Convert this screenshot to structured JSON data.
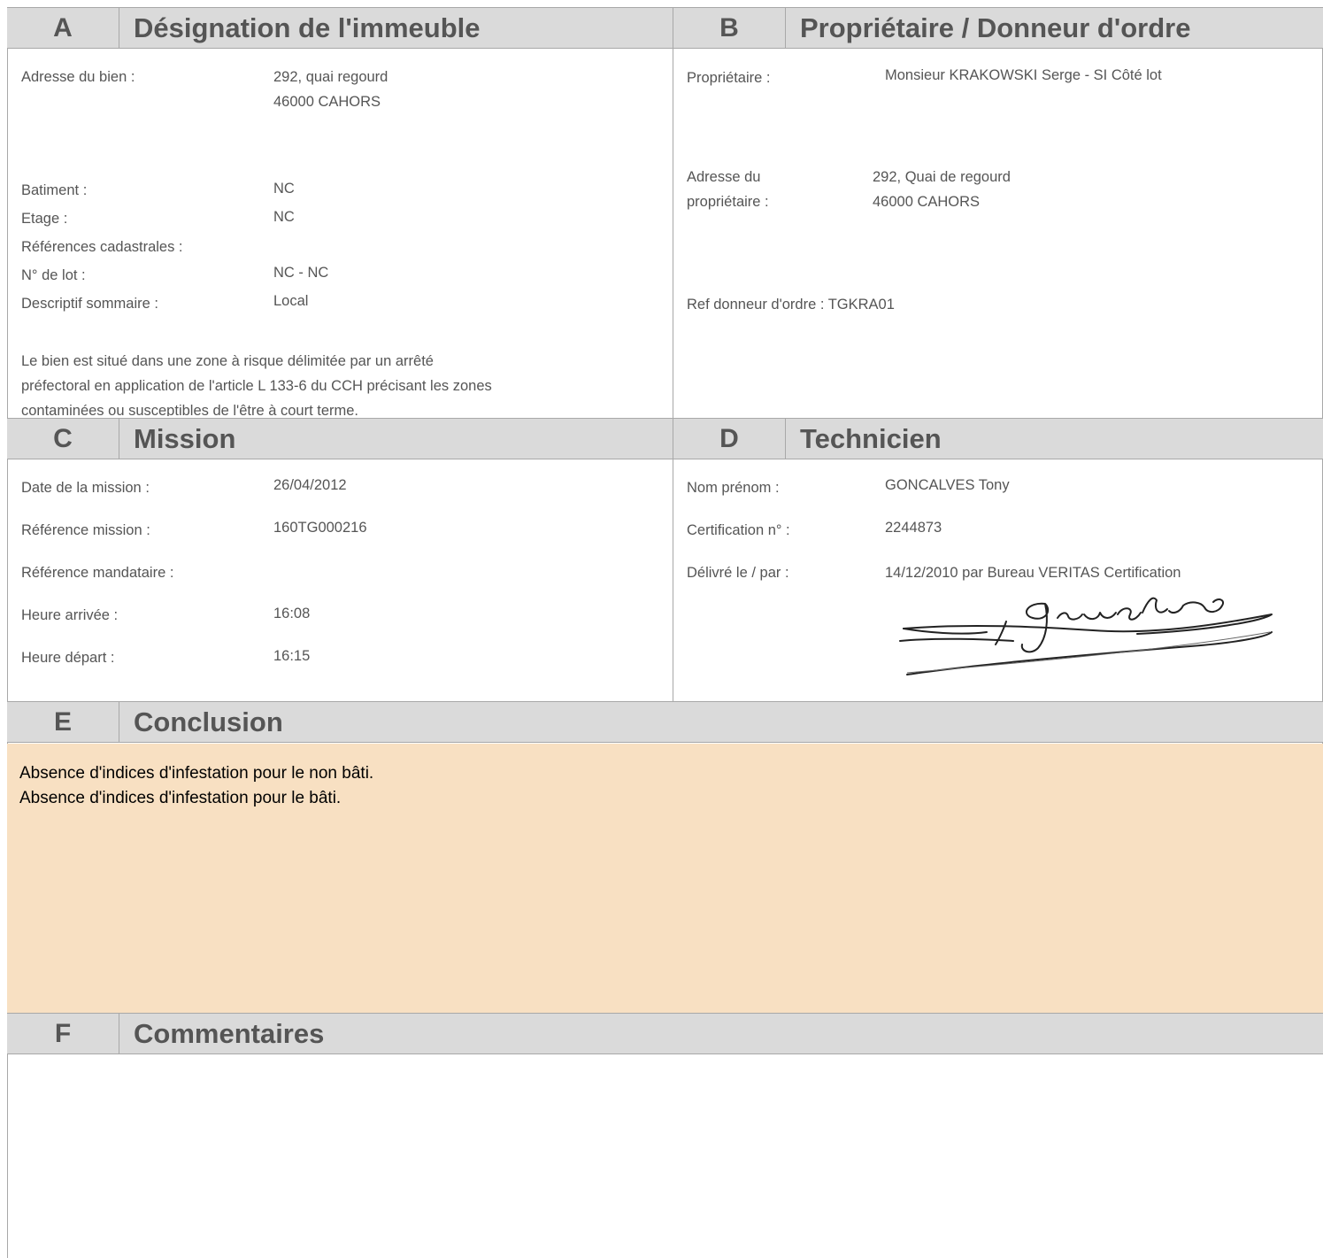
{
  "sections": {
    "a": {
      "letter": "A",
      "title": "Désignation de l'immeuble"
    },
    "b": {
      "letter": "B",
      "title": "Propriétaire / Donneur d'ordre"
    },
    "c": {
      "letter": "C",
      "title": "Mission"
    },
    "d": {
      "letter": "D",
      "title": "Technicien"
    },
    "e": {
      "letter": "E",
      "title": "Conclusion"
    },
    "f": {
      "letter": "F",
      "title": "Commentaires"
    }
  },
  "designation": {
    "adresse_label": "Adresse du bien :",
    "adresse_line1": "292, quai regourd",
    "adresse_line2": "46000 CAHORS",
    "batiment_label": "Batiment :",
    "batiment_value": "NC",
    "etage_label": "Etage :",
    "etage_value": "NC",
    "cadastre_label": "Références cadastrales :",
    "lot_label": "N° de lot :",
    "lot_value": "NC - NC",
    "descriptif_label": "Descriptif sommaire :",
    "descriptif_value": "Local",
    "zone_line1": "Le bien est situé dans une zone à risque délimitée par un arrêté",
    "zone_line2": "préfectoral en application de l'article L 133-6 du CCH précisant les zones",
    "zone_line3": "contaminées ou susceptibles de l'être à court terme."
  },
  "proprietaire": {
    "label": "Propriétaire :",
    "value": "Monsieur KRAKOWSKI Serge - SI Côté lot",
    "adresse_label_line1": "Adresse du",
    "adresse_label_line2": "propriétaire :",
    "adresse_line1": "292, Quai de regourd",
    "adresse_line2": "46000 CAHORS",
    "ref_donneur": "Ref donneur d'ordre : TGKRA01"
  },
  "mission": {
    "date_label": "Date de la mission :",
    "date_value": "26/04/2012",
    "reference_label": "Référence mission :",
    "reference_value": "160TG000216",
    "mandataire_label": "Référence mandataire :",
    "arrivee_label": "Heure arrivée :",
    "arrivee_value": "16:08",
    "depart_label": "Heure départ :",
    "depart_value": "16:15"
  },
  "technicien": {
    "nom_label": "Nom prénom :",
    "nom_value": "GONCALVES Tony",
    "certif_label": "Certification n° :",
    "certif_value": "2244873",
    "delivre_label": "Délivré le / par :",
    "delivre_value": "14/12/2010 par Bureau VERITAS Certification",
    "signature_text": "Goncalves"
  },
  "conclusion": {
    "line1": "Absence d'indices d'infestation pour le non bâti.",
    "line2": "Absence d'indices d'infestation pour le bâti."
  },
  "commentaires": {
    "text": ""
  }
}
